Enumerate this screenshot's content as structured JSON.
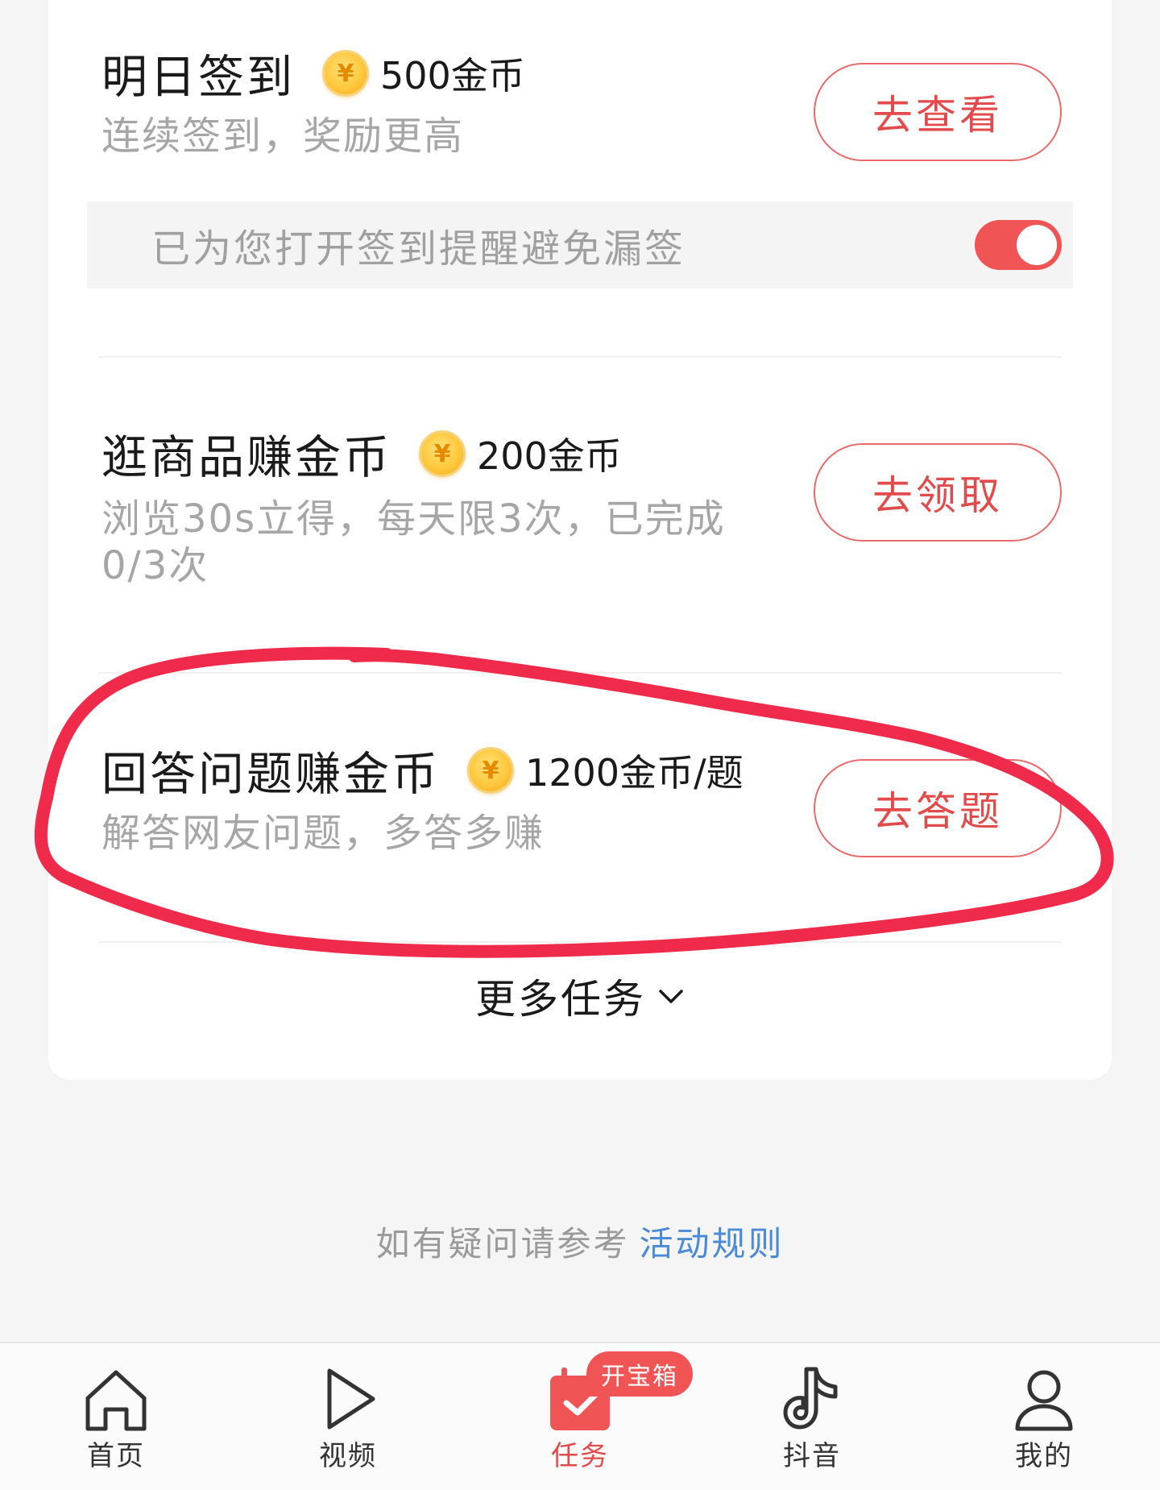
{
  "tasks": [
    {
      "title": "明日签到",
      "reward": "500金币",
      "description": "连续签到，奖励更高",
      "button": "去查看"
    },
    {
      "title": "逛商品赚金币",
      "reward": "200金币",
      "description_line1": "浏览30s立得，每天限3次，已完成",
      "description_line2": "0/3次",
      "button": "去领取"
    },
    {
      "title": "回答问题赚金币",
      "reward": "1200金币/题",
      "description": "解答网友问题，多答多赚",
      "button": "去答题"
    }
  ],
  "reminder": {
    "text": "已为您打开签到提醒避免漏签",
    "enabled": true
  },
  "coin_symbol": "¥",
  "more_tasks": "更多任务",
  "help": {
    "text": "如有疑问请参考",
    "link": "活动规则"
  },
  "tabbar": {
    "items": [
      {
        "label": "首页",
        "icon": "home-icon"
      },
      {
        "label": "视频",
        "icon": "play-icon"
      },
      {
        "label": "任务",
        "icon": "task-calendar-icon",
        "active": true
      },
      {
        "label": "抖音",
        "icon": "douyin-icon"
      },
      {
        "label": "我的",
        "icon": "profile-icon"
      }
    ],
    "badge": "开宝箱"
  },
  "colors": {
    "accent": "#e24b4b",
    "highlight_stroke": "#ef2a4a",
    "link": "#4b8ad6"
  }
}
